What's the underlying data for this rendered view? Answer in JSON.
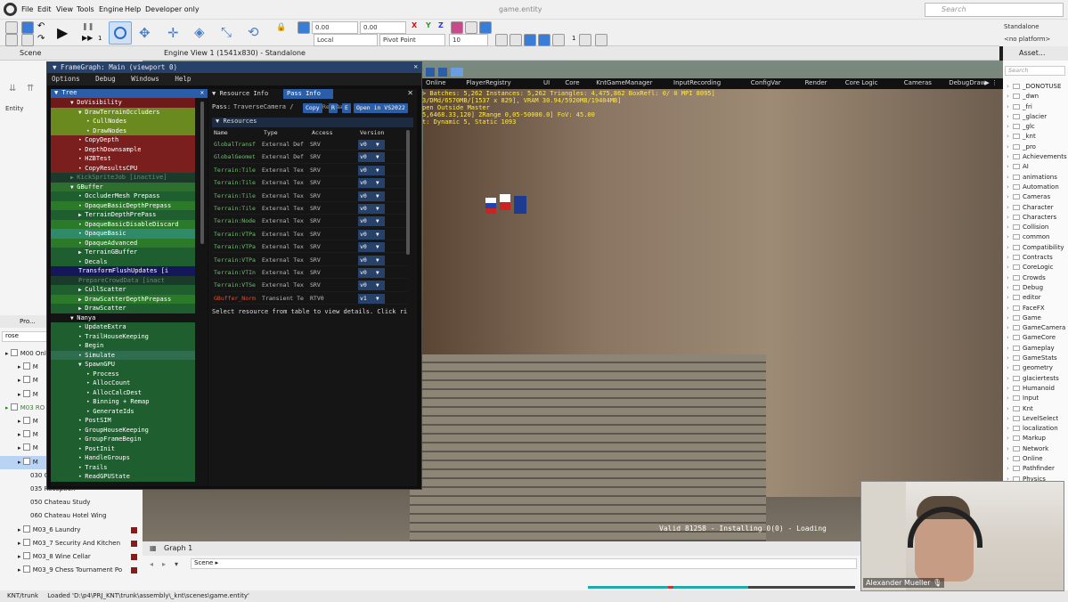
{
  "menubar": {
    "items": [
      "File",
      "Edit",
      "View",
      "Tools",
      "Engine",
      "Help",
      "Developer only"
    ],
    "window_title": "game.entity",
    "search_placeholder": "Search"
  },
  "toolbar": {
    "coord_x": "0.00",
    "coord_y": "0.00",
    "space": "Local",
    "pivot": "Pivot Point",
    "snap": "10",
    "snap2": "1",
    "tool_count": "1"
  },
  "platform": {
    "name": "Standalone",
    "sub": "<no platform>"
  },
  "scene_panel": {
    "title": "Scene",
    "entity_label": "Entity",
    "pro_label": "Pro...",
    "search_value": "rose",
    "items": [
      {
        "text": "M00 Onli",
        "indent": 0
      },
      {
        "text": "M",
        "indent": 1
      },
      {
        "text": "M",
        "indent": 1
      },
      {
        "text": "M",
        "indent": 1
      },
      {
        "text": "M03 RO",
        "indent": 0
      },
      {
        "text": "M",
        "indent": 1
      },
      {
        "text": "M",
        "indent": 1
      },
      {
        "text": "M",
        "indent": 1
      },
      {
        "text": "M",
        "indent": 1
      },
      {
        "text": "030 Chateau Tournament Rev",
        "indent": 2
      },
      {
        "text": "035 Reception",
        "indent": 2
      },
      {
        "text": "050 Chateau Study",
        "indent": 2
      },
      {
        "text": "060 Chateau Hotel Wing",
        "indent": 2
      },
      {
        "text": "M03_6 Laundry",
        "indent": 1
      },
      {
        "text": "M03_7 Security And Kitchen",
        "indent": 1
      },
      {
        "text": "M03_8 Wine Cellar",
        "indent": 1
      },
      {
        "text": "M03_9 Chess Tournament Po",
        "indent": 1
      }
    ]
  },
  "engine_view": {
    "title": "Engine View 1 (1541x830) - Standalone"
  },
  "viewport_tabs": [
    "Online",
    "PlayerRegistry",
    "UI",
    "Core",
    "KntGameManager",
    "InputRecording",
    "ConfigVar",
    "Render",
    "Core Logic",
    "Cameras",
    "DebugDraw"
  ],
  "viewport_stats": {
    "line1": "> Batches:  5,262  Instances:   5,262  Triangles: 4,475,862  BoxRefl:  0/  0  MPI 8095]",
    "line2": "3/DMd/6570MB/[1537 x 829], VRAM 30.94/5920MB/19404MB]",
    "line3": "pen Outside Master",
    "line4": "5,6468.33,120] ZRange 0,05-50000.0] FoV: 45.00",
    "line5": "t: Dynamic 5, Static 1093"
  },
  "valid_text": "Valid 81258 - Installing 0(0) - Loading",
  "graph": {
    "tab": "Graph 1",
    "scene_label": "Scene"
  },
  "status": {
    "branch": "KNT/trunk",
    "loaded": "Loaded 'D:\\p4\\PRJ_KNT\\trunk\\assembly\\_knt\\scenes\\game.entity'"
  },
  "asset_panel": {
    "title": "Asset...",
    "search_placeholder": "Search",
    "folders": [
      "_DONOTUSE",
      "_dwn",
      "_fri",
      "_glacier",
      "_glc",
      "_knt",
      "_pro",
      "Achievements",
      "AI",
      "animations",
      "Automation",
      "Cameras",
      "Character",
      "Characters",
      "Collision",
      "common",
      "Compatibility",
      "Contracts",
      "CoreLogic",
      "Crowds",
      "Debug",
      "editor",
      "FaceFX",
      "Game",
      "GameCamera",
      "GameCore",
      "Gameplay",
      "GameStats",
      "geometry",
      "glaciertests",
      "Humanoid",
      "Input",
      "Knt",
      "LevelSelect",
      "localization",
      "Markup",
      "Network",
      "Online",
      "Pathfinder",
      "Physics"
    ]
  },
  "framegraph": {
    "title": "FrameGraph: Main (viewport 0)",
    "menu": [
      "Options",
      "Debug",
      "Windows",
      "Help"
    ],
    "tree_header": "Tree",
    "nodes": [
      {
        "t": "DoVisibility",
        "d": 2,
        "arrow": "down",
        "c": "#6e1a1a"
      },
      {
        "t": "DrawTerrainOccluders",
        "d": 3,
        "arrow": "down",
        "c": "#6a8a1f"
      },
      {
        "t": "CullNodes",
        "d": 4,
        "arrow": "dot",
        "c": "#6a8a1f"
      },
      {
        "t": "DrawNodes",
        "d": 4,
        "arrow": "dot",
        "c": "#6a8a1f"
      },
      {
        "t": "CopyDepth",
        "d": 3,
        "arrow": "dot",
        "c": "#7a1e1e"
      },
      {
        "t": "DepthDownsample",
        "d": 3,
        "arrow": "dot",
        "c": "#7a1e1e"
      },
      {
        "t": "HZBTest",
        "d": 3,
        "arrow": "dot",
        "c": "#7a1e1e"
      },
      {
        "t": "CopyResultsCPU",
        "d": 3,
        "arrow": "dot",
        "c": "#7a1e1e"
      },
      {
        "t": "KickSpriteJob [inactive]",
        "d": 2,
        "arrow": "right",
        "c": "#1a3a2a"
      },
      {
        "t": "GBuffer",
        "d": 2,
        "arrow": "down",
        "c": "#2e6e2e"
      },
      {
        "t": "OccluderMesh Prepass",
        "d": 3,
        "arrow": "dot",
        "c": "#1f5f2f"
      },
      {
        "t": "OpaqueBasicDepthPrepass",
        "d": 3,
        "arrow": "dot",
        "c": "#2a7a2a"
      },
      {
        "t": "TerrainDepthPrePass",
        "d": 3,
        "arrow": "right",
        "c": "#1f5f2f"
      },
      {
        "t": "OpaqueBasicDisableDiscard",
        "d": 3,
        "arrow": "dot",
        "c": "#2a7a2a"
      },
      {
        "t": "OpaqueBasic",
        "d": 3,
        "arrow": "dot",
        "c": "#2e8a6a"
      },
      {
        "t": "OpaqueAdvanced",
        "d": 3,
        "arrow": "dot",
        "c": "#2a7a2a"
      },
      {
        "t": "TerrainGBuffer",
        "d": 3,
        "arrow": "right",
        "c": "#1f5f2f"
      },
      {
        "t": "Decals",
        "d": 3,
        "arrow": "dot",
        "c": "#1f5f2f"
      },
      {
        "t": "TransformFlushUpdates [i",
        "d": 3,
        "arrow": "none",
        "c": "#16165a"
      },
      {
        "t": "PrepareCrowdData [inact",
        "d": 3,
        "arrow": "none",
        "c": "#1a3a2a"
      },
      {
        "t": "CullScatter",
        "d": 3,
        "arrow": "right",
        "c": "#1f5f2f"
      },
      {
        "t": "DrawScatterDepthPrepass",
        "d": 3,
        "arrow": "right",
        "c": "#2a7a2a"
      },
      {
        "t": "DrawScatter",
        "d": 3,
        "arrow": "right",
        "c": "#1f5f2f"
      },
      {
        "t": "Nanya",
        "d": 2,
        "arrow": "down",
        "c": "#141414"
      },
      {
        "t": "UpdateExtra",
        "d": 3,
        "arrow": "dot",
        "c": "#1f5f2f"
      },
      {
        "t": "TrailHouseKeeping",
        "d": 3,
        "arrow": "dot",
        "c": "#1f5f2f"
      },
      {
        "t": "Begin",
        "d": 3,
        "arrow": "dot",
        "c": "#1f5f2f"
      },
      {
        "t": "Simulate",
        "d": 3,
        "arrow": "dot",
        "c": "#2e6e4e"
      },
      {
        "t": "SpawnGPU",
        "d": 3,
        "arrow": "down",
        "c": "#1f5f2f"
      },
      {
        "t": "Process",
        "d": 4,
        "arrow": "dot",
        "c": "#1f5f2f"
      },
      {
        "t": "AllocCount",
        "d": 4,
        "arrow": "dot",
        "c": "#1f5f2f"
      },
      {
        "t": "AllocCalcDest",
        "d": 4,
        "arrow": "dot",
        "c": "#1f5f2f"
      },
      {
        "t": "Binning + Remap",
        "d": 4,
        "arrow": "dot",
        "c": "#1f5f2f"
      },
      {
        "t": "GenerateIds",
        "d": 4,
        "arrow": "dot",
        "c": "#1f5f2f"
      },
      {
        "t": "PostSIM",
        "d": 3,
        "arrow": "dot",
        "c": "#1f5f2f"
      },
      {
        "t": "GroupHouseKeeping",
        "d": 3,
        "arrow": "dot",
        "c": "#1f5f2f"
      },
      {
        "t": "GroupFrameBegin",
        "d": 3,
        "arrow": "dot",
        "c": "#1f5f2f"
      },
      {
        "t": "PostInit",
        "d": 3,
        "arrow": "dot",
        "c": "#1f5f2f"
      },
      {
        "t": "HandleGroups",
        "d": 3,
        "arrow": "dot",
        "c": "#1f5f2f"
      },
      {
        "t": "Trails",
        "d": 3,
        "arrow": "dot",
        "c": "#1f5f2f"
      },
      {
        "t": "ReadGPUState",
        "d": 3,
        "arrow": "dot",
        "c": "#1f5f2f"
      }
    ],
    "tabs": [
      "Resource Info",
      "Pass Info"
    ],
    "pass_label": "Pass:",
    "pass_name": "TraverseCamera /",
    "copy_btn": "Copy",
    "pass_suffix": "Rende",
    "pass_field": "Ca",
    "btn_r": "R",
    "btn_e": "E",
    "open_btn": "Open in VS2022",
    "resources_label": "Resources",
    "columns": [
      "Name",
      "Type",
      "Access",
      "Version"
    ],
    "rows": [
      {
        "name": "GlobalTransf",
        "type": "External Def",
        "access": "SRV",
        "ver": "v0"
      },
      {
        "name": "GlobalGeomet",
        "type": "External Def",
        "access": "SRV",
        "ver": "v0"
      },
      {
        "name": "Terrain:Tile",
        "type": "External Tex",
        "access": "SRV",
        "ver": "v0"
      },
      {
        "name": "Terrain:Tile",
        "type": "External Tex",
        "access": "SRV",
        "ver": "v0"
      },
      {
        "name": "Terrain:Tile",
        "type": "External Tex",
        "access": "SRV",
        "ver": "v0"
      },
      {
        "name": "Terrain:Tile",
        "type": "External Tex",
        "access": "SRV",
        "ver": "v0"
      },
      {
        "name": "Terrain:Node",
        "type": "External Tex",
        "access": "SRV",
        "ver": "v0"
      },
      {
        "name": "Terrain:VTPa",
        "type": "External Tex",
        "access": "SRV",
        "ver": "v0"
      },
      {
        "name": "Terrain:VTPa",
        "type": "External Tex",
        "access": "SRV",
        "ver": "v0"
      },
      {
        "name": "Terrain:VTPa",
        "type": "External Tex",
        "access": "SRV",
        "ver": "v0"
      },
      {
        "name": "Terrain:VTIn",
        "type": "External Tex",
        "access": "SRV",
        "ver": "v0"
      },
      {
        "name": "Terrain:VTSe",
        "type": "External Tex",
        "access": "SRV",
        "ver": "v0"
      },
      {
        "name": "GBuffer_Norm",
        "type": "Transient Te",
        "access": "RTV0",
        "ver": "v1"
      }
    ],
    "hint": "Select resource from table to view details.  Click ri"
  },
  "video": {
    "name": "Alexander Mueller"
  }
}
